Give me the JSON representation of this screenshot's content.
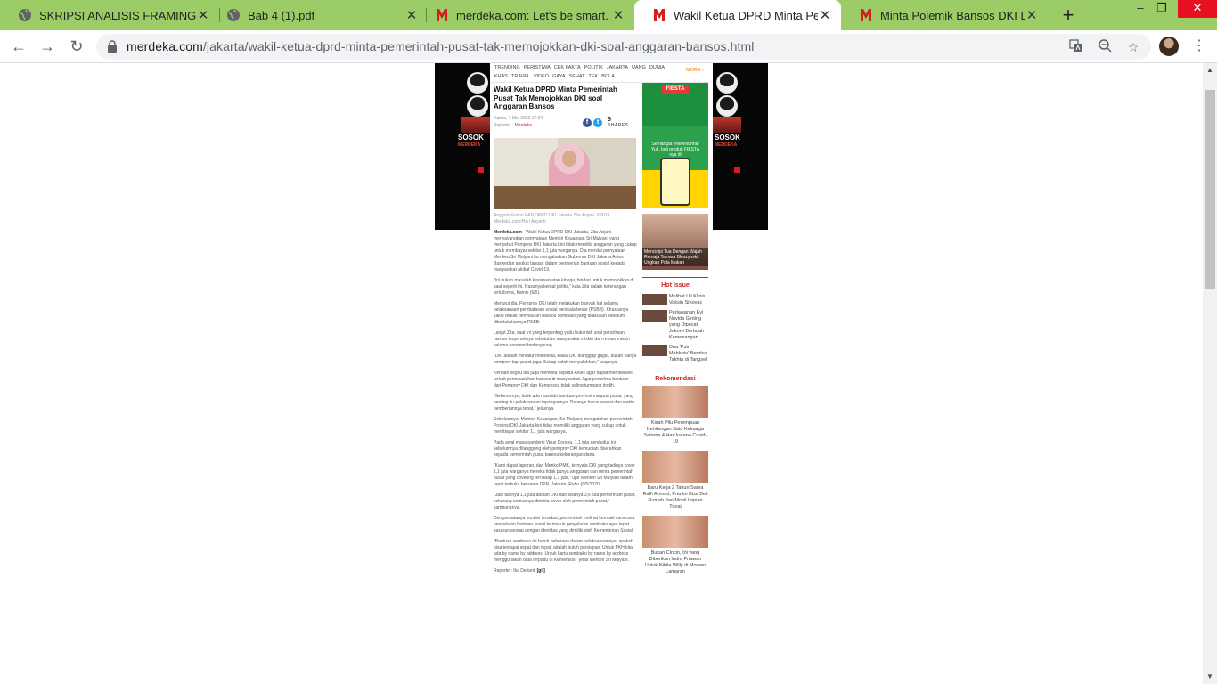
{
  "tabs": [
    {
      "title": "SKRIPSI ANALISIS FRAMING PAD",
      "icon": "globe-icon"
    },
    {
      "title": "Bab 4 (1).pdf",
      "icon": "globe-icon"
    },
    {
      "title": "merdeka.com: Let's be smart.",
      "icon": "merdeka-icon"
    },
    {
      "title": "Wakil Ketua DPRD Minta Pemer",
      "icon": "merdeka-icon",
      "active": true
    },
    {
      "title": "Minta Polemik Bansos DKI Dihe",
      "icon": "merdeka-icon"
    }
  ],
  "window": {
    "minimize": "–",
    "maximize": "❐",
    "close": "✕"
  },
  "toolbar": {
    "url_host": "merdeka.com",
    "url_path": "/jakarta/wakil-ketua-dprd-minta-pemerintah-pusat-tak-memojokkan-dki-soal-anggaran-bansos.html"
  },
  "nav": {
    "row1": [
      "TRENDING",
      "PERISTIWA",
      "CEK FAKTA",
      "POLITIK",
      "JAKARTA",
      "UANG",
      "DUNIA"
    ],
    "row2": [
      "KHAS",
      "TRAVEL",
      "VIDEO",
      "GAYA",
      "SEHAT",
      "TEK",
      "BOLA"
    ],
    "more": "MORE ›"
  },
  "skin": {
    "brand": "SOSOK",
    "sub": "MERDEKA"
  },
  "article": {
    "title": "Wakil Ketua DPRD Minta Pemerintah Pusat Tak Memojokkan DKI soal Anggaran Bansos",
    "date": "Kamis, 7 Mei 2020 17:24",
    "reporter_label": "Reporter : ",
    "reporter_name": "Merdeka",
    "shares_count": "5",
    "shares_label": "SHARES",
    "caption": "Anggota Fraksi PAN DPRD DKI Jakarta Zita Anjani. ©2019 Merdeka.com/Hari Ariyanti",
    "lead_source": "Merdeka.com",
    "lead_text": " - Wakil Ketua DPRD DKI Jakarta, Zita Anjani menyayangkan pernyataan Menteri Keuangan Sri Mulyani yang menyebut Pemprov DKI Jakarta kini tidak memiliki anggaran yang cukup untuk membayar sekitar 1,1 juta warganya. Dia menilai pernyataan Menkeu Sri Mulyani itu mengabaikan Gubernur DKI Jakarta Anies Baswedan angkat tangan dalam pemberian bantuan sosial kepada masyarakat akibat Covid-19.",
    "paragraphs": [
      "\"Ini bukan masalah kesiapan atau kinerja, hindari untuk memojokkan di saat seperti ini. Rasanya kental politis,\" kata Zita dalam keterangan tertulisnya, Kamis (6/5).",
      "Menurut dia, Pemprov DKI telah melakukan banyak hal selama pelaksanaan pembatasan sosial berskala besar (PSBB). Khususnya yakni terkait penyaluran bansos sembako yang dilakukan sebelum diberlakukannya PSBB.",
      "Lanjut Zita, saat ini yang terpenting yaitu bukanlah soal pencitraan namun terpenuhnya kebutuhan masyarakat miskin dan rentan miskin selama pandemi berlangsung.",
      "\"DKI adalah miniatur Indonesia, kalau DKI dianggap gagal, bukan hanya pemprov tapi pusat juga. Setiap salah menyalahkan,\" ucapnya.",
      "Kendati begitu dia juga meminta kepada Anies agar dapat membenahi terkait permasalahan bansos di masyarakat. Agar penerima bantuan dari Pemprov DKI dan Kemensos tidak saling tumpang tindih.",
      "\"Sebenarnya, tidak ada masalah bantuan provinsi maupun pusat, yang penting itu pelaksanaan lapangannya. Datanya harus sesuai dan waktu pemberiannya tepat,\" jelasnya.",
      "Sebelumnya, Menteri Keuangan, Sri Mulyani, mengatakan pemerintah Provinsi DKI Jakarta kini tidak memiliki anggaran yang cukup untuk membayar sekitar 1,1 juta warganya.",
      "Pada awal masa pandemi Virus Corona, 1,1 juta penduduk ini sebelumnya ditanggung oleh pemprov DKI kemudian diserahkan kepada pemerintah pusat karena kekurangan dana.",
      "\"Kami dapat laporan, dari Menko PMK, ternyata DKI yang tadinya cover 1,1 juta warganya mereka tidak punya anggaran dan minta pemerintah pusat yang covering terhadap 1,1 juta,\" ujar Menteri Sri Mulyani dalam rapat terbuka bersama DPR, Jakarta, Rabu (6/5/2020).",
      "\"Jadi tadinya 1,1 juta adalah DKI dan sisanya 3,6 juta pemerintah pusat, sekarang semuanya diminta cover oleh pemerintah pusat,\" sambungnya.",
      "Dengan adanya kondisi tersebut, pemerintah melihat kembali cara-cara penyaluran bantuan sosial termasuk penyaluran sembako agar tepat sasaran sesuai dengan identitas yang dimiliki oleh Kementerian Sosial.",
      "\"Bantuan sembako ini butuh beberapa dalam pelaksanaannya, apakah bisa tercapai sepat dan tepat, adalah butuh persiapan. Untuk PKH kita ada by name by address. Untuk kartu sembako by name by address menggunakan data terpadu di Kemensos,\" jelas Menteri Sri Mulyani."
    ],
    "footer_reporter": "Reporter: Ika Defianti",
    "footer_tag": "[gil]"
  },
  "sidebar": {
    "ad1_tag": "FIESTA",
    "ad1_text": "Semangat #NewNormal Yuk, beli produk FIESTA nya di",
    "ad2_caption": "Mencicipi Tua Dengan Wajah Remaja Tamara Bleszynski Ungkap Pola Makan",
    "hot_title": "Hot Issue",
    "hot": [
      "Melihat Uji Klinis Vaksin Sinovac",
      "Perlawanan Evi Novida Ginting yang Dipecat Jokowi Berbuah Kemenangan",
      "Dua 'Putri Mahkota' Berebut Takhta di Tangsel"
    ],
    "rec_title": "Rekomendasi",
    "rec": [
      "Kisah Pilu Perempuan Kehilangan Satu Keluarga Selama 4 Hari karena Covid-19",
      "Baru Kerja 2 Tahun Sama Raffi Ahmad, Pria Ini Bisa Beli Rumah dan Mobil Impian Tunai",
      "Bukan Cincin, Ini yang Diberikan Indra Priawan Untuk Nikita Willy di Momen Lamaran"
    ]
  },
  "colors": {
    "accent": "#d21f1f",
    "tabbar": "#9ccc65"
  }
}
